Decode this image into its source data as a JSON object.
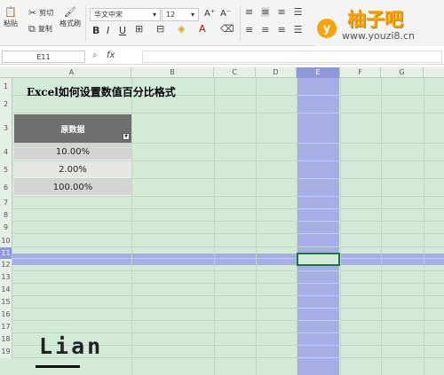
{
  "ribbon": {
    "paste": "粘贴",
    "cut": "剪切",
    "copy": "复制",
    "format_painter": "格式刷",
    "font_name": "华文中宋",
    "font_size": "12",
    "bold": "B",
    "italic": "I",
    "underline": "U",
    "grow_font": "A⁺",
    "shrink_font": "A⁻"
  },
  "logo": {
    "title": "柚子吧",
    "url": "www.youzi8.cn",
    "badge": "y"
  },
  "formula_bar": {
    "name_box": "E11",
    "fx": "fx",
    "zoom_icon": "⌕"
  },
  "columns": [
    "A",
    "B",
    "C",
    "D",
    "E",
    "F",
    "G"
  ],
  "rows": [
    "1",
    "2",
    "3",
    "4",
    "5",
    "6",
    "7",
    "8",
    "9",
    "10",
    "11",
    "12",
    "13",
    "14",
    "15",
    "16",
    "17",
    "18",
    "19"
  ],
  "sheet": {
    "title": "Excel如何设置数值百分比格式",
    "header": "原数据",
    "values": [
      "10.00%",
      "2.00%",
      "100.00%"
    ],
    "cell_colors": [
      "#d4d4d4",
      "#e6e6e6",
      "#d4d4d4"
    ]
  },
  "watermark": {
    "text": "Lian"
  },
  "colors": {
    "selection": "#a7aee6",
    "grid_bg": "#d3ead8",
    "header_bg": "#6f6f6f",
    "logo": "#f5a40f"
  }
}
